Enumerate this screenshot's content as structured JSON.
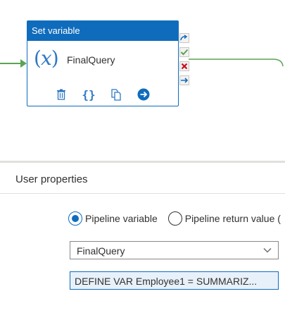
{
  "activity": {
    "header": "Set variable",
    "name": "FinalQuery",
    "icon": "variable-x-icon",
    "tools": [
      "delete-icon",
      "code-braces-icon",
      "copy-icon",
      "arrow-right-circle-icon"
    ],
    "ports": [
      "skip-arrow-icon",
      "success-check-icon",
      "failure-x-icon",
      "completion-arrow-icon"
    ],
    "colors": {
      "header": "#0f6cbd",
      "connector": "#5aa454",
      "failure": "#c50f1f"
    }
  },
  "properties": {
    "title": "User properties",
    "variable_type": {
      "options": [
        "Pipeline variable",
        "Pipeline return value ("
      ],
      "selected": "Pipeline variable"
    },
    "name_select": {
      "value": "FinalQuery"
    },
    "value_field": {
      "value": "DEFINE VAR Employee1 = SUMMARIZ..."
    }
  }
}
